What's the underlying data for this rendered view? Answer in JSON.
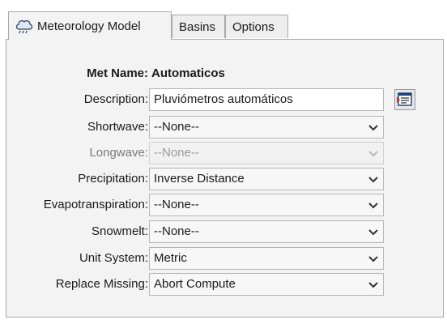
{
  "tabs": [
    {
      "label": "Meteorology Model",
      "icon": "weather-cloud-icon",
      "active": true
    },
    {
      "label": "Basins",
      "active": false
    },
    {
      "label": "Options",
      "active": false
    }
  ],
  "form": {
    "met_name_label": "Met Name:",
    "met_name_value": "Automaticos",
    "description_label": "Description:",
    "description_value": "Pluviómetros automáticos",
    "shortwave_label": "Shortwave:",
    "shortwave_value": "--None--",
    "longwave_label": "Longwave:",
    "longwave_value": "--None--",
    "precipitation_label": "Precipitation:",
    "precipitation_value": "Inverse Distance",
    "evapotranspiration_label": "Evapotranspiration:",
    "evapotranspiration_value": "--None--",
    "snowmelt_label": "Snowmelt:",
    "snowmelt_value": "--None--",
    "unit_system_label": "Unit System:",
    "unit_system_value": "Metric",
    "replace_missing_label": "Replace Missing:",
    "replace_missing_value": "Abort Compute"
  },
  "icons": {
    "tab_icon": "weather-cloud-icon",
    "description_editor": "text-editor-icon",
    "dropdown": "chevron-down-icon"
  },
  "colors": {
    "panel_bg": "#f3f3f3",
    "border": "#a8a8a8",
    "disabled_text": "#9a9a9a"
  }
}
